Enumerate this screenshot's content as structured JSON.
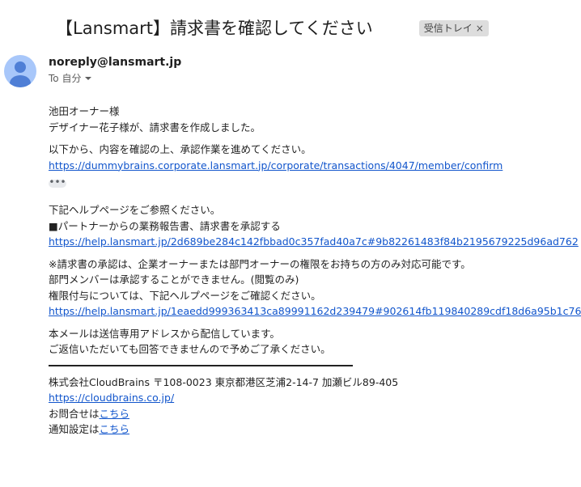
{
  "email": {
    "subject": "【Lansmart】請求書を確認してください",
    "label_chip": "受信トレイ",
    "label_chip_close": "×",
    "sender": "noreply@lansmart.jp",
    "recipient": "To 自分"
  },
  "body": {
    "greeting_line1": "池田オーナー様",
    "greeting_line2": "デザイナー花子様が、請求書を作成しました。",
    "instruction": "以下から、内容を確認の上、承認作業を進めてください。",
    "confirm_link": "https://dummybrains.corporate.lansmart.jp/corporate/transactions/4047/member/confirm",
    "ellipsis": "•••",
    "help_intro": "下記ヘルプページをご参照ください。",
    "help_item": "■パートナーからの業務報告書、請求書を承認する",
    "help_link1": "https://help.lansmart.jp/2d689be284c142fbbad0c357fad40a7c#9b82261483f84b2195679225d96ad762",
    "note_line1": "※請求書の承認は、企業オーナーまたは部門オーナーの権限をお持ちの方のみ対応可能です。",
    "note_line2": "部門メンバーは承認することができません。(閲覧のみ)",
    "note_line3": "権限付与については、下記ヘルプページをご確認ください。",
    "help_link2": "https://help.lansmart.jp/1eaedd999363413ca89991162d239479#902614fb119840289cdf18d6a95b1c76",
    "footer_line1": "本メールは送信専用アドレスから配信しています。",
    "footer_line2": "ご返信いただいても回答できませんので予めご了承ください。",
    "company_line": "株式会社CloudBrains 〒108-0023 東京都港区芝浦2-14-7 加瀬ビル89-405",
    "company_link": "https://cloudbrains.co.jp/",
    "contact_prefix": "お問合せは",
    "contact_link": "こちら",
    "notify_prefix": "通知設定は",
    "notify_link": "こちら"
  },
  "colors": {
    "link": "#1155cc",
    "avatar": "#a8c7fa",
    "avatar_figure": "#4f7fd6",
    "chip_bg": "#dddddd"
  },
  "icons": {
    "avatar": "person-avatar-icon",
    "dropdown": "chevron-down-icon",
    "chip_close": "close-icon",
    "ellipsis": "more-horizontal-icon"
  }
}
